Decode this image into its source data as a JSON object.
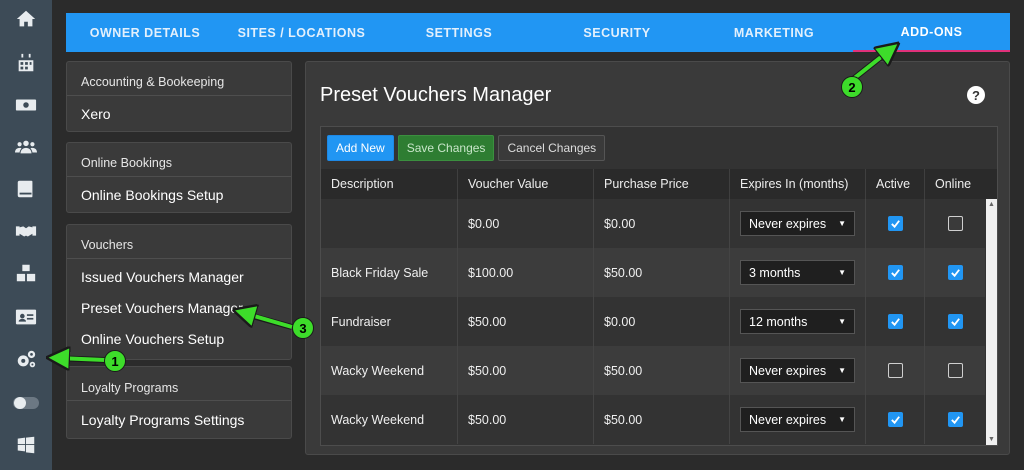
{
  "rail": {
    "items": [
      "home-icon",
      "calendar-icon",
      "cash-icon",
      "users-icon",
      "book-icon",
      "handshake-icon",
      "boxes-icon",
      "id-card-icon",
      "gears-icon",
      "toggle-icon",
      "windows-icon"
    ]
  },
  "topnav": {
    "tabs": [
      {
        "label": "OWNER DETAILS"
      },
      {
        "label": "SITES / LOCATIONS"
      },
      {
        "label": "SETTINGS"
      },
      {
        "label": "SECURITY"
      },
      {
        "label": "MARKETING"
      },
      {
        "label": "ADD-ONS"
      }
    ],
    "active_index": 5
  },
  "menu": {
    "accounting": {
      "heading": "Accounting & Bookeeping",
      "items": [
        "Xero"
      ]
    },
    "bookings": {
      "heading": "Online Bookings",
      "items": [
        "Online Bookings Setup"
      ]
    },
    "vouchers": {
      "heading": "Vouchers",
      "items": [
        "Issued Vouchers Manager",
        "Preset Vouchers Manager",
        "Online Vouchers Setup"
      ]
    },
    "loyalty": {
      "heading": "Loyalty Programs",
      "items": [
        "Loyalty Programs Settings"
      ]
    }
  },
  "main": {
    "title": "Preset Vouchers Manager",
    "help": "?",
    "toolbar": {
      "add": "Add New",
      "save": "Save Changes",
      "cancel": "Cancel Changes"
    },
    "columns": [
      "Description",
      "Voucher Value",
      "Purchase Price",
      "Expires In (months)",
      "Active",
      "Online"
    ],
    "rows": [
      {
        "description": "",
        "value": "$0.00",
        "price": "$0.00",
        "expires": "Never expires",
        "active": true,
        "online": false
      },
      {
        "description": "Black Friday Sale",
        "value": "$100.00",
        "price": "$50.00",
        "expires": "3 months",
        "active": true,
        "online": true
      },
      {
        "description": "Fundraiser",
        "value": "$50.00",
        "price": "$0.00",
        "expires": "12 months",
        "active": true,
        "online": true
      },
      {
        "description": "Wacky Weekend",
        "value": "$50.00",
        "price": "$50.00",
        "expires": "Never expires",
        "active": false,
        "online": false
      },
      {
        "description": "Wacky Weekend",
        "value": "$50.00",
        "price": "$50.00",
        "expires": "Never expires",
        "active": true,
        "online": true
      }
    ]
  },
  "annotations": {
    "step1": "1",
    "step2": "2",
    "step3": "3"
  },
  "colors": {
    "accent": "#2196f3",
    "rail": "#3d4b57",
    "annotation": "#3ddc2a",
    "active_tab_underline": "#e0317a"
  }
}
